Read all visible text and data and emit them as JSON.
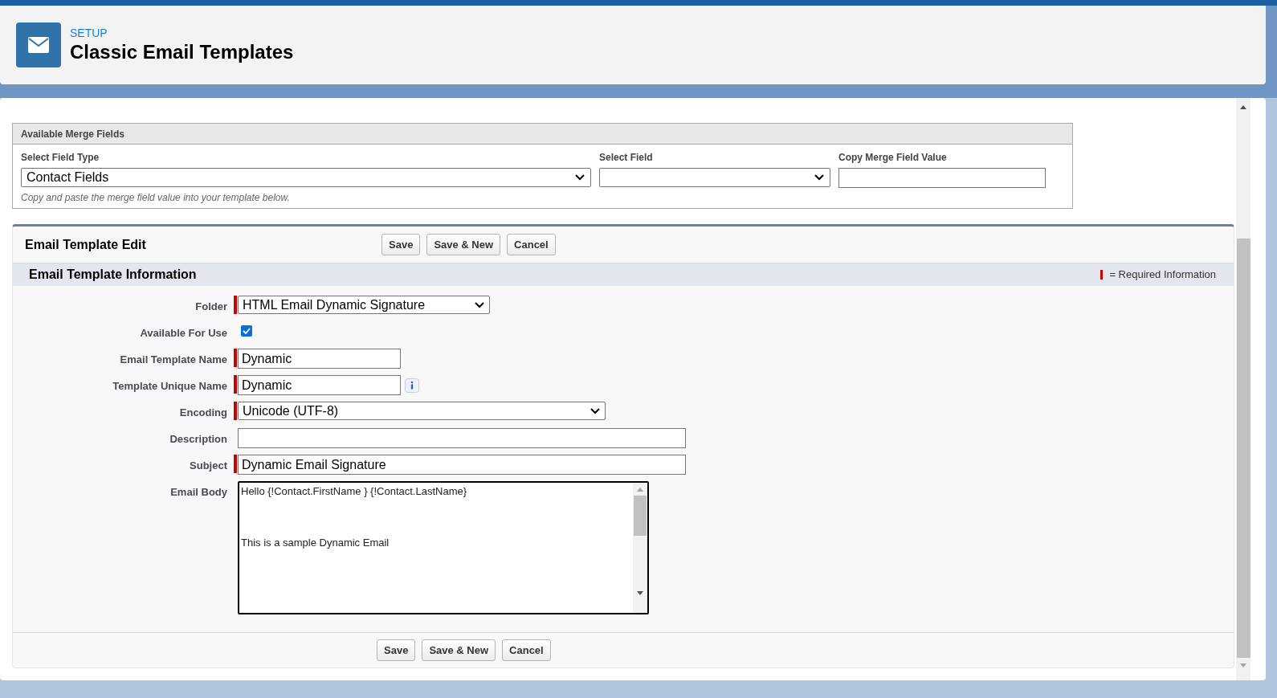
{
  "header": {
    "breadcrumb": "SETUP",
    "title": "Classic Email Templates"
  },
  "merge_fields": {
    "title": "Available Merge Fields",
    "field_type": {
      "label": "Select Field Type",
      "value": "Contact Fields"
    },
    "select_field": {
      "label": "Select Field"
    },
    "copy_value": {
      "label": "Copy Merge Field Value"
    },
    "hint": "Copy and paste the merge field value into your template below."
  },
  "edit": {
    "title": "Email Template Edit",
    "buttons": [
      "Save",
      "Save & New",
      "Cancel"
    ],
    "section_title": "Email Template Information",
    "required_legend": "= Required Information",
    "fields": [
      {
        "label": "Folder",
        "kind": "short_select",
        "required": true,
        "value": "HTML Email Dynamic Signature"
      },
      {
        "label": "Available For Use",
        "kind": "checkbox",
        "required": false,
        "checked": true
      },
      {
        "label": "Email Template Name",
        "kind": "text",
        "required": true,
        "value": "Dynamic"
      },
      {
        "label": "Template Unique Name",
        "kind": "text_info",
        "required": true,
        "value": "Dynamic"
      },
      {
        "label": "Encoding",
        "kind": "select",
        "required": true,
        "value": "Unicode (UTF-8)"
      },
      {
        "label": "Description",
        "kind": "wide_text",
        "required": false
      },
      {
        "label": "Subject",
        "kind": "wide_text",
        "required": true,
        "value": "Dynamic Email Signature"
      },
      {
        "label": "Email Body",
        "kind": "textarea",
        "required": false,
        "value": "Hello {!Contact.FirstName } {!Contact.LastName}\n\n\n\nThis is a sample Dynamic Email"
      }
    ],
    "bottom_buttons": [
      "Save",
      "Save & New",
      "Cancel"
    ]
  }
}
